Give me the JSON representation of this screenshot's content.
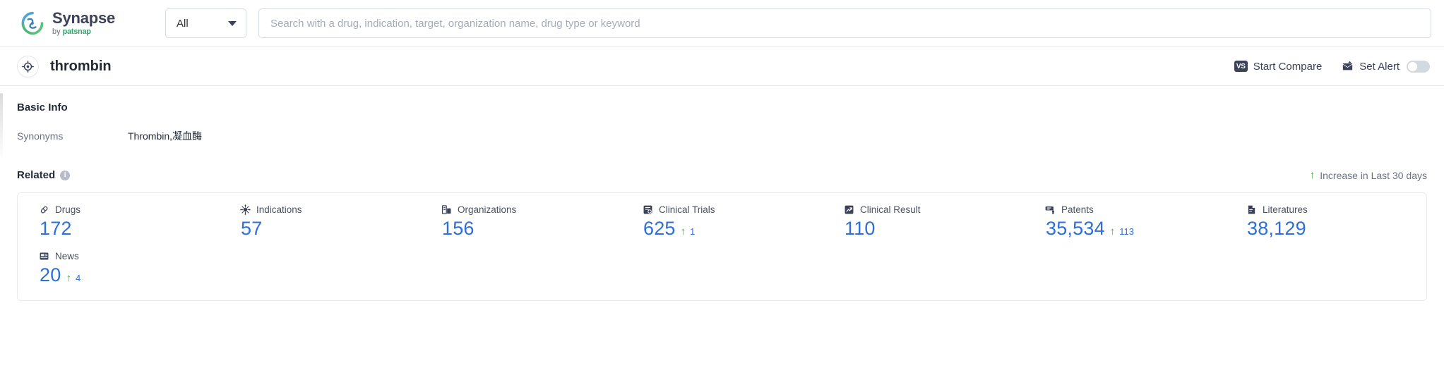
{
  "topbar": {
    "brand_name": "Synapse",
    "brand_by": "by",
    "brand_company": "patsnap",
    "category_value": "All",
    "search_placeholder": "Search with a drug, indication, target, organization name, drug type or keyword",
    "search_value": ""
  },
  "titlebar": {
    "title": "thrombin",
    "start_compare": "Start Compare",
    "compare_badge": "VS",
    "set_alert": "Set Alert",
    "alert_enabled": false
  },
  "basic_info": {
    "heading": "Basic Info",
    "synonyms_label": "Synonyms",
    "synonyms_value": "Thrombin,凝血酶"
  },
  "related": {
    "heading": "Related",
    "info_glyph": "i",
    "increase_note": "Increase in Last 30 days",
    "increase_arrow": "↑",
    "items": [
      {
        "icon": "pill-icon",
        "label": "Drugs",
        "value": "172",
        "delta": null
      },
      {
        "icon": "virus-icon",
        "label": "Indications",
        "value": "57",
        "delta": null
      },
      {
        "icon": "organization-icon",
        "label": "Organizations",
        "value": "156",
        "delta": null
      },
      {
        "icon": "clinical-trial-icon",
        "label": "Clinical Trials",
        "value": "625",
        "delta": "1"
      },
      {
        "icon": "clinical-result-icon",
        "label": "Clinical Result",
        "value": "110",
        "delta": null
      },
      {
        "icon": "patent-icon",
        "label": "Patents",
        "value": "35,534",
        "delta": "113"
      },
      {
        "icon": "literature-icon",
        "label": "Literatures",
        "value": "38,129",
        "delta": null
      },
      {
        "icon": "news-icon",
        "label": "News",
        "value": "20",
        "delta": "4"
      }
    ]
  },
  "colors": {
    "accent_blue": "#2e6fd9",
    "increase_green": "#49a942",
    "brand_dark": "#3c4257",
    "brand_green": "#2fa86b"
  }
}
